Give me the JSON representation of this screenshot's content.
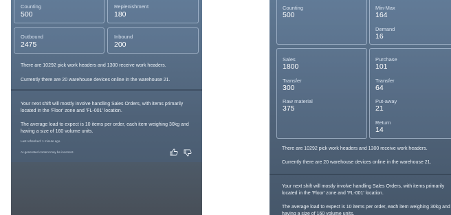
{
  "left": {
    "tiles": [
      {
        "label": "Counting",
        "value": "500"
      },
      {
        "label": "Replenishment",
        "value": "180"
      },
      {
        "label": "Outbound",
        "value": "2475"
      },
      {
        "label": "Inbound",
        "value": "200"
      }
    ],
    "info1": "There are 10292 pick work headers and 1300 receive work headers.",
    "info2": "Currently there are 20 warehouse devices online in the warehouse 21.",
    "summary1": "Your next shift will mostly involve handling Sales Orders, with items primarily located in the 'Floor' zone and 'FL-001' location.",
    "summary2": "The average load to expect is 10 items per order, each item weighing 30kg and having a size of 160 volume units.",
    "refreshed": "Last refreshed: 1 minute ago.",
    "disclaimer": "AI-generated content may be incorrect.",
    "icons": {
      "like": "thumbs-up-icon",
      "dislike": "thumbs-down-icon"
    }
  },
  "right": {
    "counting": {
      "label": "Counting",
      "value": "500"
    },
    "minmax": {
      "label": "Min-Max",
      "value": "164"
    },
    "demand": {
      "label": "Demand",
      "value": "16"
    },
    "sales": {
      "label": "Sales",
      "value": "1800"
    },
    "transfer_out": {
      "label": "Transfer",
      "value": "300"
    },
    "raw": {
      "label": "Raw material",
      "value": "375"
    },
    "purchase": {
      "label": "Purchase",
      "value": "101"
    },
    "transfer_in": {
      "label": "Transfer",
      "value": "64"
    },
    "putaway": {
      "label": "Put-away",
      "value": "21"
    },
    "return": {
      "label": "Return",
      "value": "14"
    },
    "info1": "There are 10292 pick work headers and 1300 receive work headers.",
    "info2": "Currently there are 20 warehouse devices online in the warehouse 21.",
    "summary1": "Your next shift will mostly involve handling Sales Orders, with items primarily located in the 'Floor' zone and 'FL-001' location.",
    "summary2": "The average load to expect is 10 items per order, each item weighing 30kg and having a size of 160 volume units."
  }
}
